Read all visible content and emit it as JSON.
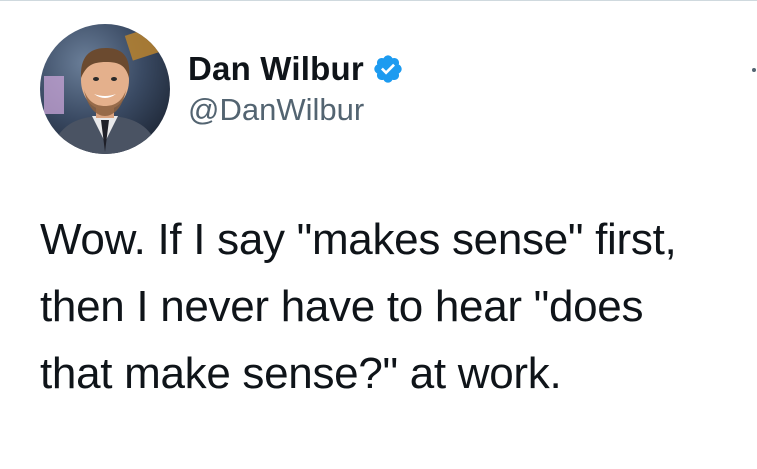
{
  "tweet": {
    "author": {
      "display_name": "Dan Wilbur",
      "handle": "@DanWilbur",
      "verified": true,
      "avatar_icon": "profile-photo"
    },
    "text_lines": [
      "Wow. If I say \"makes sense\" first,",
      "then I never have to hear \"does",
      "that make sense?\" at work."
    ]
  },
  "colors": {
    "text": "#0f1419",
    "secondary_text": "#536471",
    "verified_badge": "#1d9bf0",
    "background": "#ffffff"
  }
}
